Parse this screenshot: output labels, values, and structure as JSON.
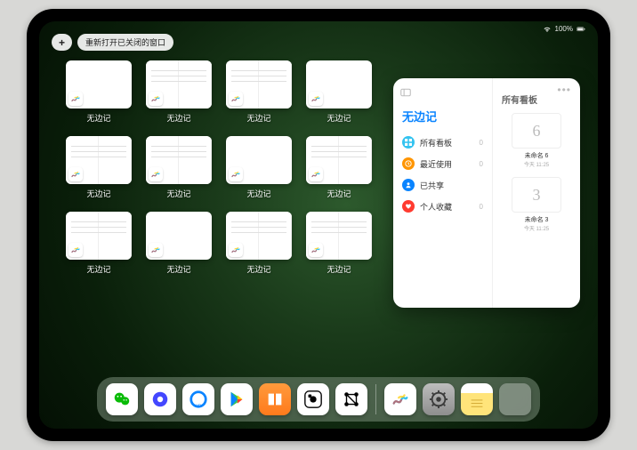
{
  "status": {
    "battery": "100%"
  },
  "top": {
    "plus": "+",
    "reopen_label": "重新打开已关闭的窗口"
  },
  "app": {
    "name": "无边记"
  },
  "thumbs": [
    {
      "label": "无边记",
      "split": false
    },
    {
      "label": "无边记",
      "split": true
    },
    {
      "label": "无边记",
      "split": true
    },
    {
      "label": "无边记",
      "split": false
    },
    {
      "label": "无边记",
      "split": true
    },
    {
      "label": "无边记",
      "split": true
    },
    {
      "label": "无边记",
      "split": false
    },
    {
      "label": "无边记",
      "split": true
    },
    {
      "label": "无边记",
      "split": true
    },
    {
      "label": "无边记",
      "split": false
    },
    {
      "label": "无边记",
      "split": true
    },
    {
      "label": "无边记",
      "split": true
    }
  ],
  "panel": {
    "title": "无边记",
    "right_title": "所有看板",
    "menu": [
      {
        "icon": "grid",
        "color": "#34c3f0",
        "label": "所有看板",
        "count": "0"
      },
      {
        "icon": "clock",
        "color": "#ff9500",
        "label": "最近使用",
        "count": "0"
      },
      {
        "icon": "people",
        "color": "#0a84ff",
        "label": "已共享",
        "count": ""
      },
      {
        "icon": "heart",
        "color": "#ff3b30",
        "label": "个人收藏",
        "count": "0"
      }
    ],
    "boards": [
      {
        "glyph": "6",
        "name": "未命名 6",
        "time": "今天 11:25"
      },
      {
        "glyph": "3",
        "name": "未命名 3",
        "time": "今天 11:25"
      }
    ]
  },
  "dock": {
    "apps": [
      {
        "name": "wechat",
        "bg": "#fff"
      },
      {
        "name": "quark",
        "bg": "#fff"
      },
      {
        "name": "qqbrowser",
        "bg": "#fff"
      },
      {
        "name": "play",
        "bg": "#fff"
      },
      {
        "name": "books",
        "bg": "linear-gradient(#ff9a3c,#ff7a1c)"
      },
      {
        "name": "dice",
        "bg": "#fff"
      },
      {
        "name": "graph",
        "bg": "#fff"
      }
    ],
    "recent": [
      {
        "name": "freeform",
        "bg": "#fff"
      },
      {
        "name": "settings",
        "bg": "linear-gradient(#bdbdbd,#8e8e8e)"
      },
      {
        "name": "notes",
        "bg": "linear-gradient(#fff 30%,#ffe47a 30%)"
      }
    ],
    "library": {
      "name": "app-library"
    }
  }
}
